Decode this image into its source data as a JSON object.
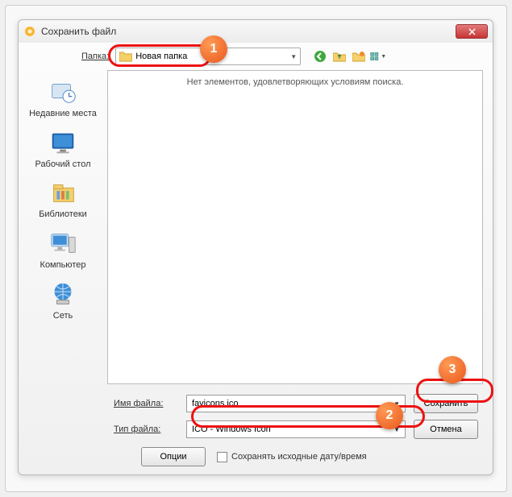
{
  "window": {
    "title": "Сохранить файл"
  },
  "topbar": {
    "folderLabel": "Папка:",
    "folderName": "Новая папка"
  },
  "places": {
    "recent": "Недавние места",
    "desktop": "Рабочий стол",
    "libraries": "Библиотеки",
    "computer": "Компьютер",
    "network": "Сеть"
  },
  "fileArea": {
    "emptyMsg": "Нет элементов, удовлетворяющих условиям поиска."
  },
  "lower": {
    "filenameLabel": "Имя файла:",
    "filenameValue": "favicons.ico",
    "filetypeLabel": "Тип файла:",
    "filetypeValue": "ICO - Windows Icon",
    "saveBtn": "Сохранить",
    "cancelBtn": "Отмена",
    "optionsBtn": "Опции",
    "preserveCheck": "Сохранять исходные дату/время"
  },
  "callouts": {
    "c1": "1",
    "c2": "2",
    "c3": "3"
  }
}
